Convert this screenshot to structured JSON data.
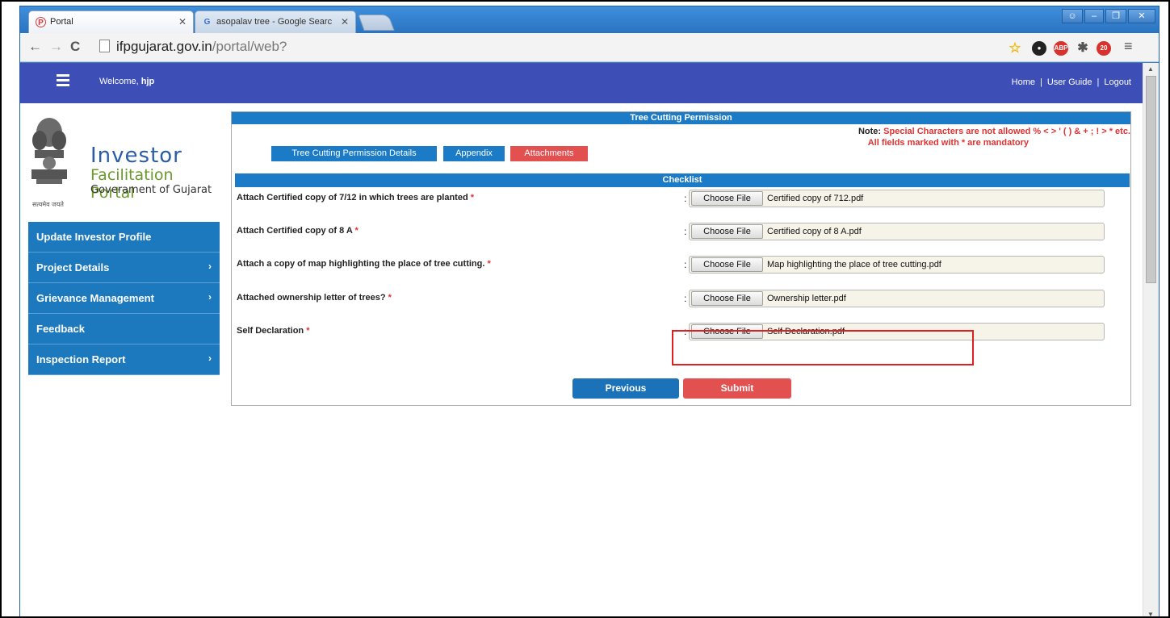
{
  "browser": {
    "tabs": [
      {
        "title": "Portal",
        "active": true
      },
      {
        "title": "asopalav tree - Google Searc",
        "active": false
      }
    ],
    "url_host": "ifpgujarat.gov.in",
    "url_path": "/portal/web?",
    "ext_badge": "20"
  },
  "header": {
    "welcome_prefix": "Welcome,",
    "username": "hjp",
    "links": [
      "Home",
      "User Guide",
      "Logout"
    ],
    "color": "#3d4fb7"
  },
  "logo": {
    "line1": "Investor",
    "line2": "Facilitation Portal",
    "line3": "Goverament of Gujarat",
    "motto": "सत्यमेव जयते"
  },
  "sidebar": {
    "items": [
      {
        "label": "Update Investor Profile",
        "has_chevron": false
      },
      {
        "label": "Project Details",
        "has_chevron": true
      },
      {
        "label": "Grievance Management",
        "has_chevron": true
      },
      {
        "label": "Feedback",
        "has_chevron": false
      },
      {
        "label": "Inspection Report",
        "has_chevron": true
      }
    ]
  },
  "form": {
    "title": "Tree Cutting Permission",
    "note_label": "Note:",
    "note_text": "Special Characters are not allowed % < > ' ( ) & + ; ! > * etc.",
    "mandatory_text": "All fields marked with * are mandatory",
    "tabs": [
      {
        "label": "Tree Cutting Permission Details",
        "color": "#1b7bc6"
      },
      {
        "label": "Appendix",
        "color": "#1b7bc6"
      },
      {
        "label": "Attachments",
        "color": "#e35050"
      }
    ],
    "checklist_title": "Checklist",
    "rows": [
      {
        "label": "Attach Certified copy of 7/12 in which trees are planted",
        "button": "Choose File",
        "file": "Certified copy of 712.pdf"
      },
      {
        "label": "Attach Certified copy of 8 A",
        "button": "Choose File",
        "file": "Certified copy of 8 A.pdf"
      },
      {
        "label": "Attach a copy of map highlighting the place of tree cutting.",
        "button": "Choose File",
        "file": "Map highlighting the place of tree cutting.pdf"
      },
      {
        "label": "Attached ownership letter of trees?",
        "button": "Choose File",
        "file": "Ownership letter.pdf"
      },
      {
        "label": "Self Declaration",
        "button": "Choose File",
        "file": "Self Declaration.pdf"
      }
    ],
    "previous_label": "Previous",
    "submit_label": "Submit"
  }
}
